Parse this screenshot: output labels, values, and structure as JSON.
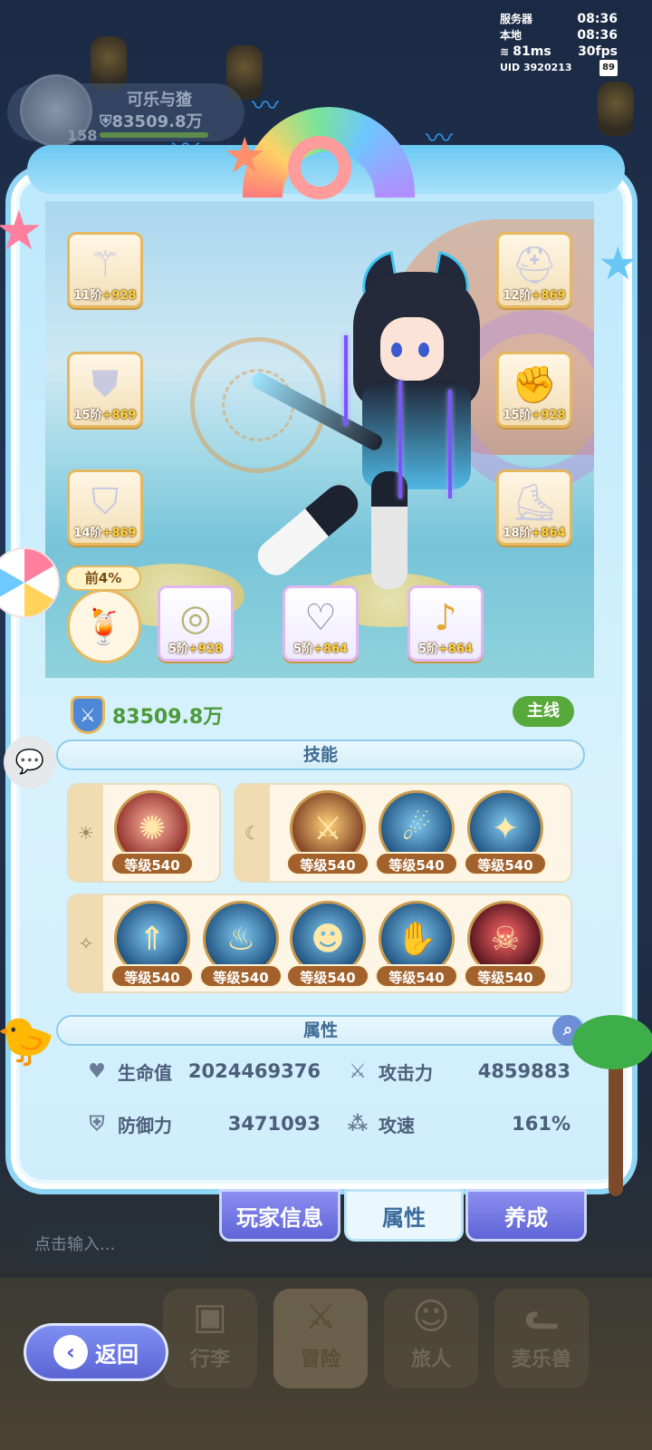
{
  "status": {
    "server_label": "服务器",
    "server_time": "08:36",
    "local_label": "本地",
    "local_time": "08:36",
    "ping": "81ms",
    "fps": "30fps",
    "uid": "UID 3920213",
    "battery": "89"
  },
  "player": {
    "name": "可乐与猹",
    "power": "83509.8万",
    "level": "158"
  },
  "equipment_left": [
    {
      "tier": "11阶",
      "bonus": "+928",
      "icon": "staff-icon"
    },
    {
      "tier": "15阶",
      "bonus": "+869",
      "icon": "armor-icon"
    },
    {
      "tier": "14阶",
      "bonus": "+869",
      "icon": "robe-icon"
    }
  ],
  "equipment_right": [
    {
      "tier": "12阶",
      "bonus": "+869",
      "icon": "helmet-icon"
    },
    {
      "tier": "15阶",
      "bonus": "+928",
      "icon": "gauntlet-icon"
    },
    {
      "tier": "18阶",
      "bonus": "+864",
      "icon": "boots-icon"
    }
  ],
  "pet": {
    "badge": "前4%",
    "icon": "cocktail-icon"
  },
  "accessories": [
    {
      "tier": "5阶",
      "bonus": "+928",
      "icon": "ring-icon"
    },
    {
      "tier": "5阶",
      "bonus": "+864",
      "icon": "necklace-icon"
    },
    {
      "tier": "5阶",
      "bonus": "+864",
      "icon": "earring-icon"
    }
  ],
  "combat_power": "83509.8万",
  "mainline_label": "主线",
  "skills_title": "技能",
  "skill_level": "等级540",
  "attributes_title": "属性",
  "attributes": {
    "hp_label": "生命值",
    "hp_value": "2024469376",
    "atk_label": "攻击力",
    "atk_value": "4859883",
    "def_label": "防御力",
    "def_value": "3471093",
    "spd_label": "攻速",
    "spd_value": "161%"
  },
  "tabs": [
    "玩家信息",
    "属性",
    "养成"
  ],
  "chat_placeholder": "点击输入...",
  "nav": [
    "行李",
    "冒险",
    "旅人",
    "麦乐兽"
  ],
  "back_label": "返回",
  "colors": {
    "accent": "#5f64d6",
    "power_green": "#4d9a3a",
    "level_brown": "#a3622b"
  }
}
